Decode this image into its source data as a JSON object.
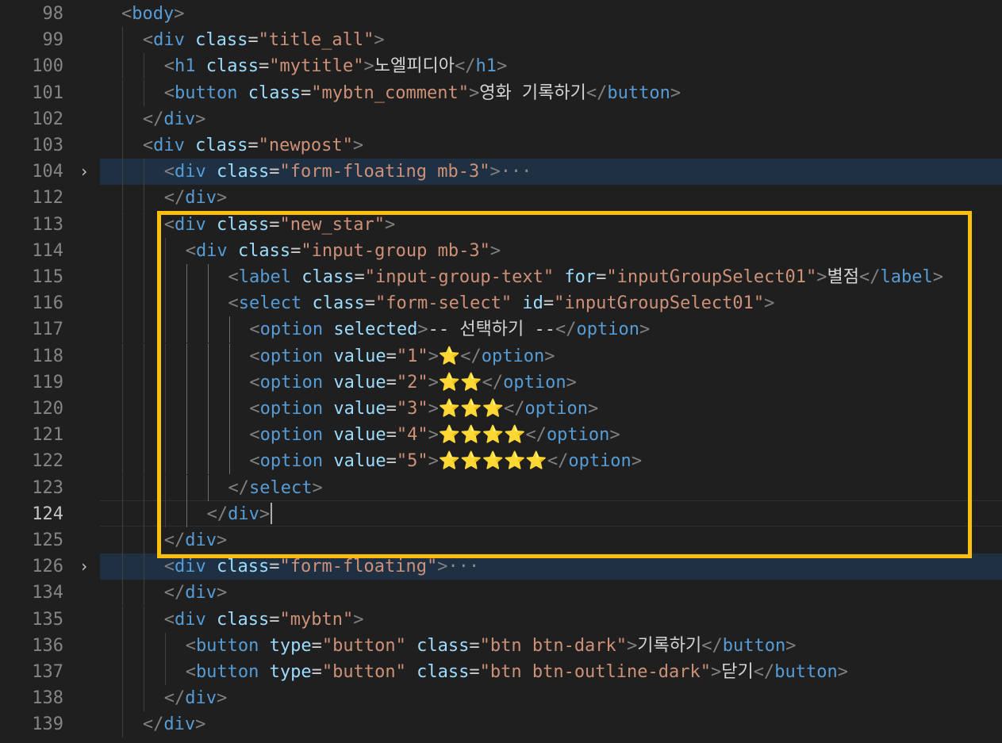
{
  "editor": {
    "fold_icon": "chevron-right-icon",
    "highlight_color": "#fbbf0c",
    "active_line": "124",
    "lines": [
      {
        "num": "98",
        "indent": 1,
        "tokens": [
          [
            "br",
            "<"
          ],
          [
            "tag",
            "body"
          ],
          [
            "br",
            ">"
          ]
        ]
      },
      {
        "num": "99",
        "indent": 2,
        "tokens": [
          [
            "br",
            "<"
          ],
          [
            "tag",
            "div"
          ],
          [
            "txt",
            " "
          ],
          [
            "attr",
            "class"
          ],
          [
            "eq",
            "="
          ],
          [
            "str",
            "\"title_all\""
          ],
          [
            "br",
            ">"
          ]
        ]
      },
      {
        "num": "100",
        "indent": 3,
        "tokens": [
          [
            "br",
            "<"
          ],
          [
            "tag",
            "h1"
          ],
          [
            "txt",
            " "
          ],
          [
            "attr",
            "class"
          ],
          [
            "eq",
            "="
          ],
          [
            "str",
            "\"mytitle\""
          ],
          [
            "br",
            ">"
          ],
          [
            "txt",
            "노엘피디아"
          ],
          [
            "br",
            "</"
          ],
          [
            "tag",
            "h1"
          ],
          [
            "br",
            ">"
          ]
        ]
      },
      {
        "num": "101",
        "indent": 3,
        "tokens": [
          [
            "br",
            "<"
          ],
          [
            "tag",
            "button"
          ],
          [
            "txt",
            " "
          ],
          [
            "attr",
            "class"
          ],
          [
            "eq",
            "="
          ],
          [
            "str",
            "\"mybtn_comment\""
          ],
          [
            "br",
            ">"
          ],
          [
            "txt",
            "영화 기록하기"
          ],
          [
            "br",
            "</"
          ],
          [
            "tag",
            "button"
          ],
          [
            "br",
            ">"
          ]
        ]
      },
      {
        "num": "102",
        "indent": 2,
        "tokens": [
          [
            "br",
            "</"
          ],
          [
            "tag",
            "div"
          ],
          [
            "br",
            ">"
          ]
        ]
      },
      {
        "num": "103",
        "indent": 2,
        "tokens": [
          [
            "br",
            "<"
          ],
          [
            "tag",
            "div"
          ],
          [
            "txt",
            " "
          ],
          [
            "attr",
            "class"
          ],
          [
            "eq",
            "="
          ],
          [
            "str",
            "\"newpost\""
          ],
          [
            "br",
            ">"
          ]
        ]
      },
      {
        "num": "104",
        "indent": 3,
        "folded": true,
        "tokens": [
          [
            "br",
            "<"
          ],
          [
            "tag",
            "div"
          ],
          [
            "txt",
            " "
          ],
          [
            "attr",
            "class"
          ],
          [
            "eq",
            "="
          ],
          [
            "str",
            "\"form-floating mb-3\""
          ],
          [
            "br",
            ">"
          ],
          [
            "ell",
            "···"
          ]
        ]
      },
      {
        "num": "112",
        "indent": 3,
        "tokens": [
          [
            "br",
            "</"
          ],
          [
            "tag",
            "div"
          ],
          [
            "br",
            ">"
          ]
        ]
      },
      {
        "num": "113",
        "indent": 3,
        "tokens": [
          [
            "br",
            "<"
          ],
          [
            "tag",
            "div"
          ],
          [
            "txt",
            " "
          ],
          [
            "attr",
            "class"
          ],
          [
            "eq",
            "="
          ],
          [
            "str",
            "\"new_star\""
          ],
          [
            "br",
            ">"
          ]
        ]
      },
      {
        "num": "114",
        "indent": 4,
        "tokens": [
          [
            "br",
            "<"
          ],
          [
            "tag",
            "div"
          ],
          [
            "txt",
            " "
          ],
          [
            "attr",
            "class"
          ],
          [
            "eq",
            "="
          ],
          [
            "str",
            "\"input-group mb-3\""
          ],
          [
            "br",
            ">"
          ]
        ]
      },
      {
        "num": "115",
        "indent": 6,
        "tokens": [
          [
            "br",
            "<"
          ],
          [
            "tag",
            "label"
          ],
          [
            "txt",
            " "
          ],
          [
            "attr",
            "class"
          ],
          [
            "eq",
            "="
          ],
          [
            "str",
            "\"input-group-text\""
          ],
          [
            "txt",
            " "
          ],
          [
            "attr",
            "for"
          ],
          [
            "eq",
            "="
          ],
          [
            "str",
            "\"inputGroupSelect01\""
          ],
          [
            "br",
            ">"
          ],
          [
            "txt",
            "별점"
          ],
          [
            "br",
            "</"
          ],
          [
            "tag",
            "label"
          ],
          [
            "br",
            ">"
          ]
        ]
      },
      {
        "num": "116",
        "indent": 6,
        "tokens": [
          [
            "br",
            "<"
          ],
          [
            "tag",
            "select"
          ],
          [
            "txt",
            " "
          ],
          [
            "attr",
            "class"
          ],
          [
            "eq",
            "="
          ],
          [
            "str",
            "\"form-select\""
          ],
          [
            "txt",
            " "
          ],
          [
            "attr",
            "id"
          ],
          [
            "eq",
            "="
          ],
          [
            "str",
            "\"inputGroupSelect01\""
          ],
          [
            "br",
            ">"
          ]
        ]
      },
      {
        "num": "117",
        "indent": 7,
        "tokens": [
          [
            "br",
            "<"
          ],
          [
            "tag",
            "option"
          ],
          [
            "txt",
            " "
          ],
          [
            "attr",
            "selected"
          ],
          [
            "br",
            ">"
          ],
          [
            "txt",
            "-- 선택하기 --"
          ],
          [
            "br",
            "</"
          ],
          [
            "tag",
            "option"
          ],
          [
            "br",
            ">"
          ]
        ]
      },
      {
        "num": "118",
        "indent": 7,
        "tokens": [
          [
            "br",
            "<"
          ],
          [
            "tag",
            "option"
          ],
          [
            "txt",
            " "
          ],
          [
            "attr",
            "value"
          ],
          [
            "eq",
            "="
          ],
          [
            "str",
            "\"1\""
          ],
          [
            "br",
            ">"
          ],
          [
            "star",
            "⭐"
          ],
          [
            "br",
            "</"
          ],
          [
            "tag",
            "option"
          ],
          [
            "br",
            ">"
          ]
        ]
      },
      {
        "num": "119",
        "indent": 7,
        "tokens": [
          [
            "br",
            "<"
          ],
          [
            "tag",
            "option"
          ],
          [
            "txt",
            " "
          ],
          [
            "attr",
            "value"
          ],
          [
            "eq",
            "="
          ],
          [
            "str",
            "\"2\""
          ],
          [
            "br",
            ">"
          ],
          [
            "star",
            "⭐⭐"
          ],
          [
            "br",
            "</"
          ],
          [
            "tag",
            "option"
          ],
          [
            "br",
            ">"
          ]
        ]
      },
      {
        "num": "120",
        "indent": 7,
        "tokens": [
          [
            "br",
            "<"
          ],
          [
            "tag",
            "option"
          ],
          [
            "txt",
            " "
          ],
          [
            "attr",
            "value"
          ],
          [
            "eq",
            "="
          ],
          [
            "str",
            "\"3\""
          ],
          [
            "br",
            ">"
          ],
          [
            "star",
            "⭐⭐⭐"
          ],
          [
            "br",
            "</"
          ],
          [
            "tag",
            "option"
          ],
          [
            "br",
            ">"
          ]
        ]
      },
      {
        "num": "121",
        "indent": 7,
        "tokens": [
          [
            "br",
            "<"
          ],
          [
            "tag",
            "option"
          ],
          [
            "txt",
            " "
          ],
          [
            "attr",
            "value"
          ],
          [
            "eq",
            "="
          ],
          [
            "str",
            "\"4\""
          ],
          [
            "br",
            ">"
          ],
          [
            "star",
            "⭐⭐⭐⭐"
          ],
          [
            "br",
            "</"
          ],
          [
            "tag",
            "option"
          ],
          [
            "br",
            ">"
          ]
        ]
      },
      {
        "num": "122",
        "indent": 7,
        "tokens": [
          [
            "br",
            "<"
          ],
          [
            "tag",
            "option"
          ],
          [
            "txt",
            " "
          ],
          [
            "attr",
            "value"
          ],
          [
            "eq",
            "="
          ],
          [
            "str",
            "\"5\""
          ],
          [
            "br",
            ">"
          ],
          [
            "star",
            "⭐⭐⭐⭐⭐"
          ],
          [
            "br",
            "</"
          ],
          [
            "tag",
            "option"
          ],
          [
            "br",
            ">"
          ]
        ]
      },
      {
        "num": "123",
        "indent": 6,
        "tokens": [
          [
            "br",
            "</"
          ],
          [
            "tag",
            "select"
          ],
          [
            "br",
            ">"
          ]
        ]
      },
      {
        "num": "124",
        "indent": 5,
        "active": true,
        "tokens": [
          [
            "br",
            "</"
          ],
          [
            "tag",
            "div"
          ],
          [
            "br",
            ">"
          ]
        ]
      },
      {
        "num": "125",
        "indent": 3,
        "tokens": [
          [
            "br",
            "</"
          ],
          [
            "tag",
            "div"
          ],
          [
            "br",
            ">"
          ]
        ]
      },
      {
        "num": "126",
        "indent": 3,
        "folded": true,
        "tokens": [
          [
            "br",
            "<"
          ],
          [
            "tag",
            "div"
          ],
          [
            "txt",
            " "
          ],
          [
            "attr",
            "class"
          ],
          [
            "eq",
            "="
          ],
          [
            "str",
            "\"form-floating\""
          ],
          [
            "br",
            ">"
          ],
          [
            "ell",
            "···"
          ]
        ]
      },
      {
        "num": "134",
        "indent": 3,
        "tokens": [
          [
            "br",
            "</"
          ],
          [
            "tag",
            "div"
          ],
          [
            "br",
            ">"
          ]
        ]
      },
      {
        "num": "135",
        "indent": 3,
        "tokens": [
          [
            "br",
            "<"
          ],
          [
            "tag",
            "div"
          ],
          [
            "txt",
            " "
          ],
          [
            "attr",
            "class"
          ],
          [
            "eq",
            "="
          ],
          [
            "str",
            "\"mybtn\""
          ],
          [
            "br",
            ">"
          ]
        ]
      },
      {
        "num": "136",
        "indent": 4,
        "tokens": [
          [
            "br",
            "<"
          ],
          [
            "tag",
            "button"
          ],
          [
            "txt",
            " "
          ],
          [
            "attr",
            "type"
          ],
          [
            "eq",
            "="
          ],
          [
            "str",
            "\"button\""
          ],
          [
            "txt",
            " "
          ],
          [
            "attr",
            "class"
          ],
          [
            "eq",
            "="
          ],
          [
            "str",
            "\"btn btn-dark\""
          ],
          [
            "br",
            ">"
          ],
          [
            "txt",
            "기록하기"
          ],
          [
            "br",
            "</"
          ],
          [
            "tag",
            "button"
          ],
          [
            "br",
            ">"
          ]
        ]
      },
      {
        "num": "137",
        "indent": 4,
        "tokens": [
          [
            "br",
            "<"
          ],
          [
            "tag",
            "button"
          ],
          [
            "txt",
            " "
          ],
          [
            "attr",
            "type"
          ],
          [
            "eq",
            "="
          ],
          [
            "str",
            "\"button\""
          ],
          [
            "txt",
            " "
          ],
          [
            "attr",
            "class"
          ],
          [
            "eq",
            "="
          ],
          [
            "str",
            "\"btn btn-outline-dark\""
          ],
          [
            "br",
            ">"
          ],
          [
            "txt",
            "닫기"
          ],
          [
            "br",
            "</"
          ],
          [
            "tag",
            "button"
          ],
          [
            "br",
            ">"
          ]
        ]
      },
      {
        "num": "138",
        "indent": 3,
        "tokens": [
          [
            "br",
            "</"
          ],
          [
            "tag",
            "div"
          ],
          [
            "br",
            ">"
          ]
        ]
      },
      {
        "num": "139",
        "indent": 2,
        "tokens": [
          [
            "br",
            "</"
          ],
          [
            "tag",
            "div"
          ],
          [
            "br",
            ">"
          ]
        ]
      }
    ]
  }
}
